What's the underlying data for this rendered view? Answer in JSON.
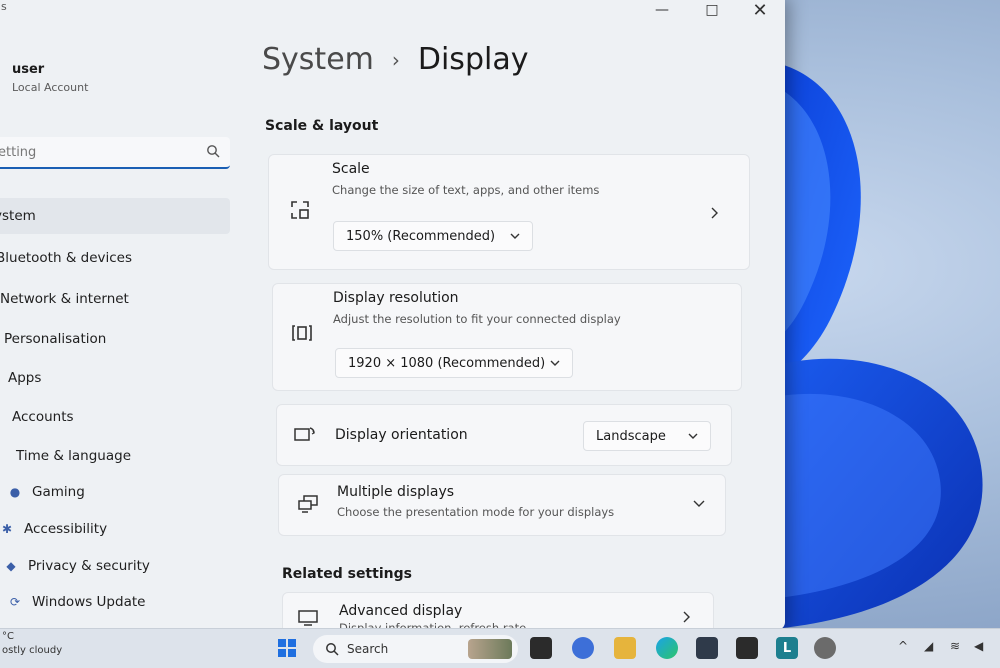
{
  "window": {
    "app_title": "gs",
    "controls": {
      "minimize": "—",
      "maximize": "□",
      "close": "✕"
    }
  },
  "user": {
    "name": "user",
    "account_type": "Local Account"
  },
  "search": {
    "placeholder": "etting"
  },
  "sidebar": {
    "items": [
      {
        "label": "ystem",
        "active": true
      },
      {
        "label": "Bluetooth & devices"
      },
      {
        "label": "Network & internet"
      },
      {
        "label": "Personalisation"
      },
      {
        "label": "Apps"
      },
      {
        "label": "Accounts"
      },
      {
        "label": "Time & language"
      },
      {
        "label": "Gaming"
      },
      {
        "label": "Accessibility"
      },
      {
        "label": "Privacy & security"
      },
      {
        "label": "Windows Update"
      }
    ]
  },
  "breadcrumb": {
    "parent": "System",
    "current": "Display"
  },
  "sections": {
    "scale_layout": "Scale & layout",
    "related": "Related settings"
  },
  "scale": {
    "title": "Scale",
    "subtitle": "Change the size of text, apps, and other items",
    "value": "150% (Recommended)"
  },
  "resolution": {
    "title": "Display resolution",
    "subtitle": "Adjust the resolution to fit your connected display",
    "value": "1920 × 1080 (Recommended)"
  },
  "orientation": {
    "title": "Display orientation",
    "value": "Landscape"
  },
  "multiple": {
    "title": "Multiple displays",
    "subtitle": "Choose the presentation mode for your displays"
  },
  "advanced": {
    "title": "Advanced display",
    "subtitle": "Display information, refresh rate"
  },
  "taskbar": {
    "weather_temp": "°C",
    "weather_desc": "ostly cloudy",
    "search_label": "Search",
    "pinned_letter": "L"
  },
  "colors": {
    "accent": "#1a5fb4",
    "wallpaper": "#1d4fc9"
  }
}
